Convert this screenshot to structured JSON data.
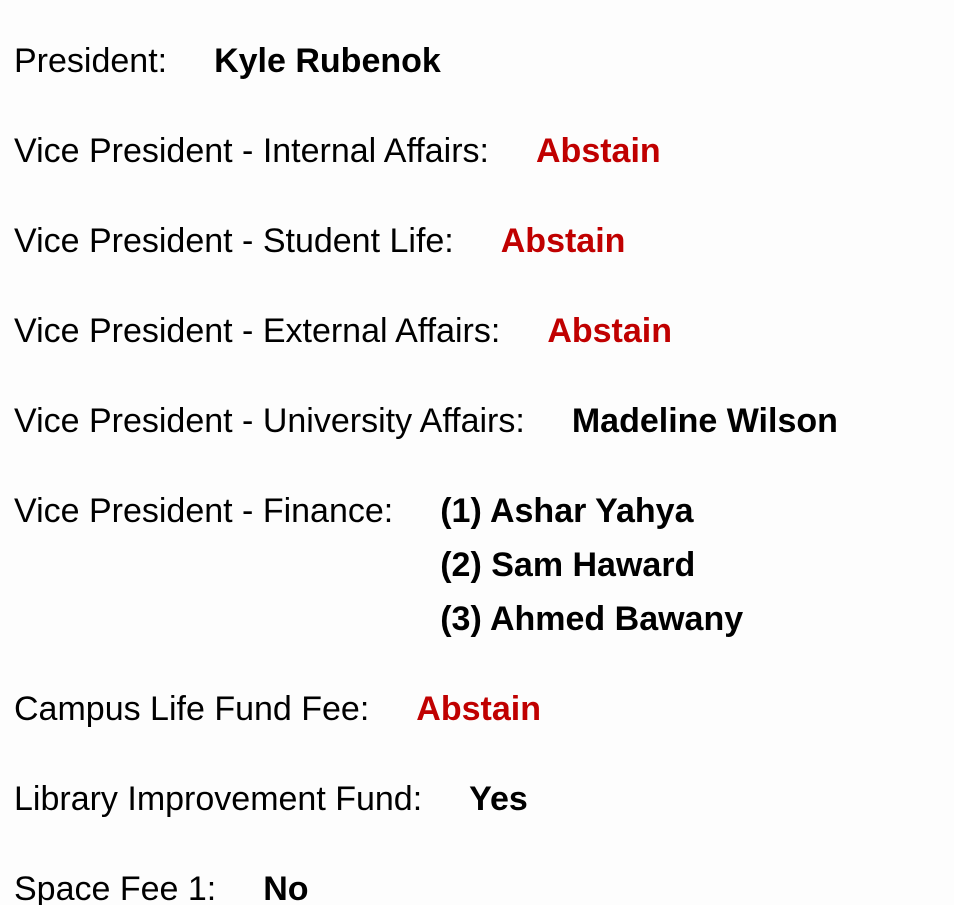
{
  "ballot": {
    "colors": {
      "abstain": "#c00000",
      "text": "#000000",
      "background": "#fdfdfd"
    },
    "items": [
      {
        "label": "President:",
        "value": "Kyle Rubenok",
        "abstain": false
      },
      {
        "label": "Vice President - Internal Affairs:",
        "value": "Abstain",
        "abstain": true
      },
      {
        "label": "Vice President - Student Life:",
        "value": "Abstain",
        "abstain": true
      },
      {
        "label": "Vice President - External Affairs:",
        "value": "Abstain",
        "abstain": true
      },
      {
        "label": "Vice President - University Affairs:",
        "value": "Madeline Wilson",
        "abstain": false
      },
      {
        "label": "Vice President - Finance:",
        "choices": [
          "(1) Ashar Yahya",
          "(2) Sam Haward",
          "(3) Ahmed Bawany"
        ]
      },
      {
        "label": "Campus Life Fund Fee:",
        "value": "Abstain",
        "abstain": true
      },
      {
        "label": "Library Improvement Fund:",
        "value": "Yes",
        "abstain": false
      },
      {
        "label": "Space Fee 1:",
        "value": "No",
        "abstain": false
      }
    ]
  }
}
